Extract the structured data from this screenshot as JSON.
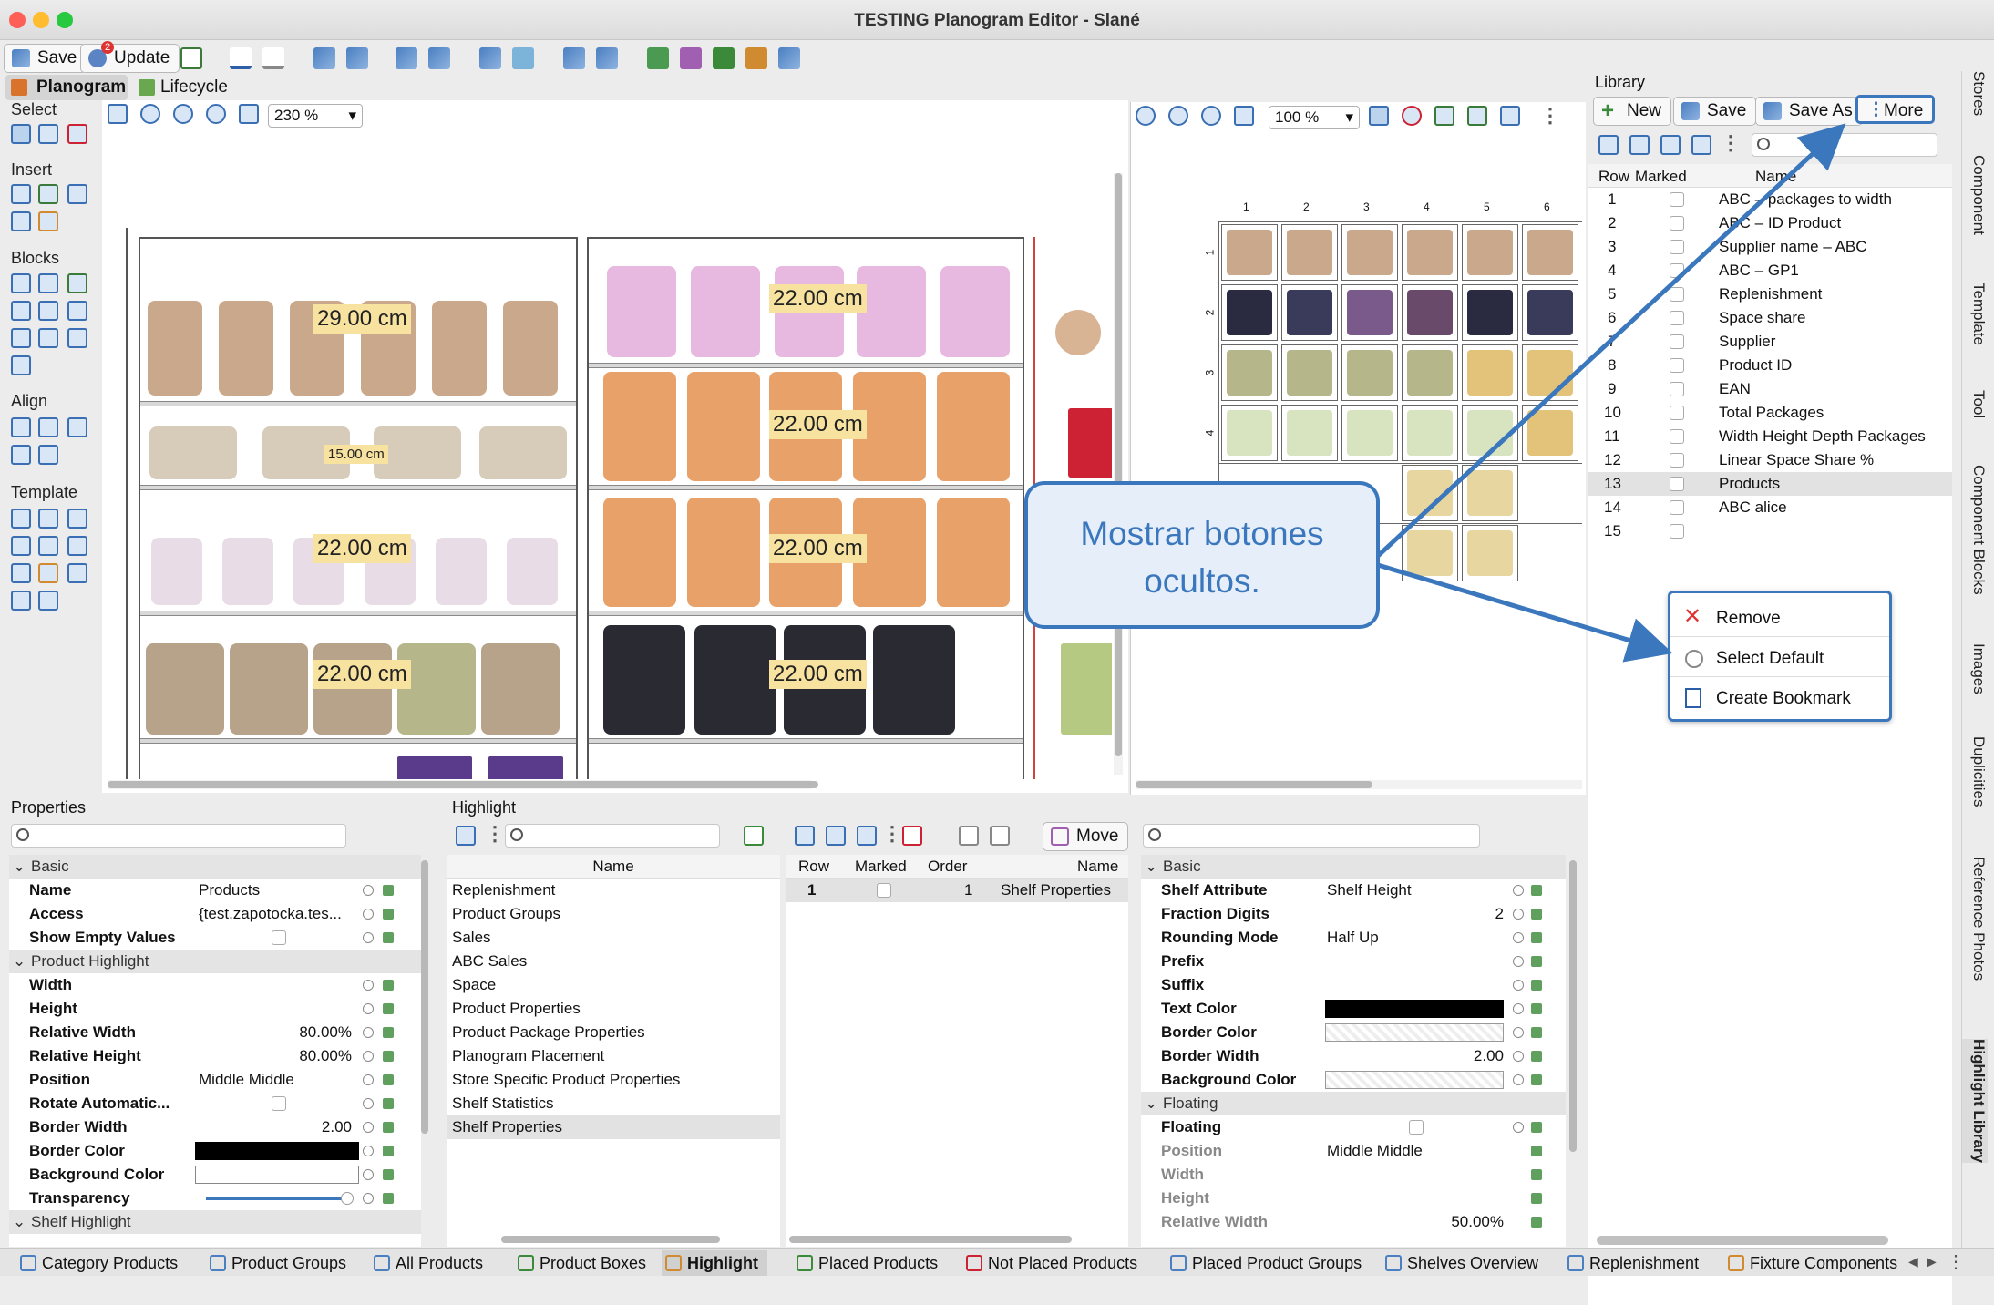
{
  "window": {
    "title": "TESTING Planogram Editor - Slané"
  },
  "toolbar": {
    "save": "Save",
    "update": "Update",
    "update_badge": "2"
  },
  "tabs": {
    "planogram": "Planogram",
    "lifecycle": "Lifecycle"
  },
  "tool_sections": {
    "select": "Select",
    "insert": "Insert",
    "blocks": "Blocks",
    "align": "Align",
    "template": "Template"
  },
  "left_canvas": {
    "zoom": "230 %",
    "labels": [
      "29.00 cm",
      "15.00 cm",
      "22.00 cm",
      "22.00 cm",
      "22.00 cm",
      "22.00 cm",
      "22.00 cm",
      "22.00 cm"
    ]
  },
  "right_canvas": {
    "zoom": "100 %",
    "col_numbers": [
      "1",
      "2",
      "3",
      "4",
      "5",
      "6"
    ],
    "row_numbers": [
      "1",
      "2",
      "3",
      "4"
    ]
  },
  "library": {
    "title": "Library",
    "buttons": {
      "new": "New",
      "save": "Save",
      "save_as": "Save As",
      "more": "More"
    },
    "headers": {
      "row": "Row",
      "marked": "Marked",
      "name": "Name"
    },
    "rows": [
      {
        "row": "1",
        "name": "ABC – packages to width"
      },
      {
        "row": "2",
        "name": "ABC – ID Product"
      },
      {
        "row": "3",
        "name": "Supplier name – ABC"
      },
      {
        "row": "4",
        "name": "ABC – GP1"
      },
      {
        "row": "5",
        "name": "Replenishment"
      },
      {
        "row": "6",
        "name": "Space share"
      },
      {
        "row": "7",
        "name": "Supplier"
      },
      {
        "row": "8",
        "name": "Product ID"
      },
      {
        "row": "9",
        "name": "EAN"
      },
      {
        "row": "10",
        "name": "Total Packages"
      },
      {
        "row": "11",
        "name": "Width Height Depth Packages"
      },
      {
        "row": "12",
        "name": "Linear Space Share %"
      },
      {
        "row": "13",
        "name": "Products"
      },
      {
        "row": "14",
        "name": "ABC alice"
      },
      {
        "row": "15",
        "name": ""
      }
    ],
    "popup": {
      "remove": "Remove",
      "select_default": "Select Default",
      "create_bookmark": "Create Bookmark"
    }
  },
  "callout": {
    "line1": "Mostrar botones",
    "line2": "ocultos."
  },
  "properties": {
    "title": "Properties",
    "basic": "Basic",
    "name_k": "Name",
    "name_v": "Products",
    "access_k": "Access",
    "access_v": "{test.zapotocka.tes...",
    "show_empty_k": "Show Empty Values",
    "product_highlight": "Product Highlight",
    "width_k": "Width",
    "height_k": "Height",
    "rel_width_k": "Relative Width",
    "rel_width_v": "80.00%",
    "rel_height_k": "Relative Height",
    "rel_height_v": "80.00%",
    "position_k": "Position",
    "position_v": "Middle Middle",
    "rotate_k": "Rotate Automatic...",
    "border_width_k": "Border Width",
    "border_width_v": "2.00",
    "border_color_k": "Border Color",
    "bg_color_k": "Background Color",
    "transparency_k": "Transparency",
    "shelf_highlight": "Shelf Highlight"
  },
  "highlight": {
    "title": "Highlight",
    "name_header": "Name",
    "items": [
      "Replenishment",
      "Product Groups",
      "Sales",
      "ABC Sales",
      "Space",
      "Product Properties",
      "Product Package Properties",
      "Planogram Placement",
      "Store Specific Product Properties",
      "Shelf Statistics",
      "Shelf Properties"
    ],
    "move": "Move",
    "headers": {
      "row": "Row",
      "marked": "Marked",
      "order": "Order",
      "name": "Name"
    },
    "row1": {
      "row": "1",
      "order": "1",
      "name": "Shelf Properties"
    }
  },
  "shelf_props": {
    "basic": "Basic",
    "shelf_attr_k": "Shelf Attribute",
    "shelf_attr_v": "Shelf Height",
    "fraction_k": "Fraction Digits",
    "fraction_v": "2",
    "rounding_k": "Rounding Mode",
    "rounding_v": "Half Up",
    "prefix_k": "Prefix",
    "suffix_k": "Suffix",
    "text_color_k": "Text Color",
    "border_color_k": "Border Color",
    "border_width_k": "Border Width",
    "border_width_v": "2.00",
    "bg_color_k": "Background Color",
    "floating_group": "Floating",
    "floating_k": "Floating",
    "position_k": "Position",
    "position_v": "Middle Middle",
    "width_k": "Width",
    "height_k": "Height",
    "rel_width_k": "Relative Width",
    "rel_width_v": "50.00%"
  },
  "bottom_tabs": [
    "Category Products",
    "Product Groups",
    "All Products",
    "Product Boxes",
    "Highlight",
    "Placed Products",
    "Not Placed Products",
    "Placed Product Groups",
    "Shelves Overview",
    "Replenishment",
    "Fixture Components"
  ],
  "side_tabs": [
    "Stores",
    "Component",
    "Template",
    "Tool",
    "Component Blocks",
    "Images",
    "Duplicities",
    "Reference Photos",
    "Highlight Library"
  ]
}
